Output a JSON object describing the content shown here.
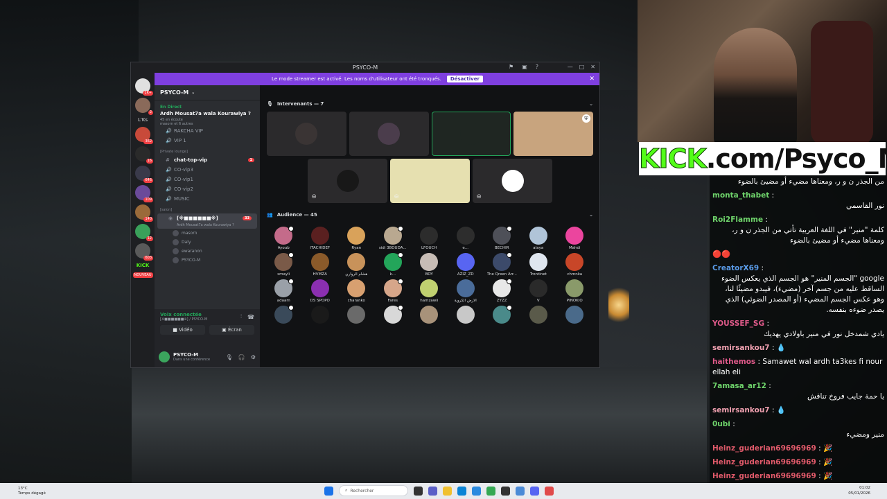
{
  "window": {
    "title": "PSYCO-M",
    "controls": [
      "minimize",
      "maximize",
      "close"
    ]
  },
  "banner": {
    "text": "Le mode streamer est activé. Les noms d'utilisateur ont été tronqués.",
    "button": "Désactiver"
  },
  "servers": {
    "labels": [
      "L'Ks",
      "KICK"
    ],
    "badges": [
      "1K+",
      "362",
      "16",
      "646",
      "109",
      "140",
      "12",
      "603",
      "35"
    ],
    "nouveau": "NOUVEAU"
  },
  "sidebar": {
    "guild_name": "PSYCO-M",
    "live_label": "En Direct",
    "live_title": "Ardh Mousat7a wala Kourawiya ?",
    "live_sub": "45 en écoute",
    "live_sub2": "masorn et 6 autres",
    "channels": [
      {
        "icon": "speaker",
        "label": "RAKCHA VIP"
      },
      {
        "icon": "speaker",
        "label": "VIP 1"
      }
    ],
    "category_private": "[Private lounge]",
    "private_channels": [
      {
        "icon": "hash",
        "label": "chat-top-vip",
        "count": "1"
      },
      {
        "icon": "speaker",
        "label": "CO-vip3"
      },
      {
        "icon": "speaker",
        "label": "CO-vip1"
      },
      {
        "icon": "speaker",
        "label": "CO-vip2"
      },
      {
        "icon": "speaker",
        "label": "MUSIC"
      }
    ],
    "category_salon": "[salon]",
    "active_stage": {
      "label": "[※■■■■■■※]",
      "sub": "Ardh Mousat7a wala Kourawiya ?",
      "count": "33"
    },
    "voice_users": [
      "masorn",
      "Daly",
      "ewaranon",
      "PSYCO-M"
    ]
  },
  "voice_panel": {
    "status": "Voix connectée",
    "sub": "[※■■■■■■※] / PSYCO-M",
    "video_label": "Vidéo",
    "screen_label": "Écran"
  },
  "user_panel": {
    "name": "PSYCO-M",
    "status": "Dans une conférence"
  },
  "stage": {
    "speakers_header": "Intervenants — 7",
    "audience_header": "Audience — 45",
    "speaker_colors": [
      "#3a3434",
      "#4b3d4c",
      "#1f2622",
      "#c8a47e",
      "#181818",
      "#e6e0b0",
      "#181818"
    ],
    "audience": [
      {
        "name": "Ayoub",
        "color": "#c46b8a"
      },
      {
        "name": "ITACHIDEF",
        "color": "#5a2020"
      },
      {
        "name": "Ryan",
        "color": "#d9a25a"
      },
      {
        "name": "sidi 3BOUDA...",
        "color": "#b9a890"
      },
      {
        "name": "LFOUCH",
        "color": "#2c2c2c"
      },
      {
        "name": "e...",
        "color": "#2d2d2d"
      },
      {
        "name": "BECHIR",
        "color": "#4e5058"
      },
      {
        "name": "alaya",
        "color": "#b0c4d8"
      },
      {
        "name": "Mahdi",
        "color": "#eb459e"
      },
      {
        "name": "smayli",
        "color": "#7a5a48"
      },
      {
        "name": "HVMZA",
        "color": "#8a5a2a"
      },
      {
        "name": "هشام الرواري",
        "color": "#c8925a"
      },
      {
        "name": "k...",
        "color": "#23a55a"
      },
      {
        "name": "BOY",
        "color": "#c7bcb5"
      },
      {
        "name": "AZIZ_ZD",
        "color": "#5865f2"
      },
      {
        "name": "The Qreen Arr...",
        "color": "#3c4a6a"
      },
      {
        "name": "Trontinet",
        "color": "#dfe6ef"
      },
      {
        "name": "chmnka",
        "color": "#c84628"
      },
      {
        "name": "adaam",
        "color": "#9aa0a8"
      },
      {
        "name": "DS SPOPO",
        "color": "#8b2fb0"
      },
      {
        "name": "charanko",
        "color": "#d8a070"
      },
      {
        "name": "Fares",
        "color": "#d6a68a"
      },
      {
        "name": "hamzawii",
        "color": "#c0d070"
      },
      {
        "name": "الأرض الكروية",
        "color": "#4a6c9a"
      },
      {
        "name": "ZYZZ",
        "color": "#e8e8e8"
      },
      {
        "name": "V",
        "color": "#2a2a2a"
      },
      {
        "name": "PINOKIO",
        "color": "#8a9a6a"
      },
      {
        "name": "",
        "color": "#3a4a5a"
      },
      {
        "name": "",
        "color": "#1a1a1a"
      },
      {
        "name": "",
        "color": "#6a6a6a"
      },
      {
        "name": "",
        "color": "#d8d8d8"
      },
      {
        "name": "",
        "color": "#a8927a"
      },
      {
        "name": "",
        "color": "#c8c8c8"
      },
      {
        "name": "",
        "color": "#4a8a8a"
      },
      {
        "name": "",
        "color": "#5a5a4a"
      },
      {
        "name": "",
        "color": "#4a6a8a"
      }
    ]
  },
  "stream": {
    "brand_kick": "KICK",
    "brand_rest": ".com/Psyco_M"
  },
  "chat": [
    {
      "user": "",
      "text": "من الجذر ن و ر، ومعناها مضيء أو مضيئ بالضوء",
      "color": "#ffffff"
    },
    {
      "user": "monta_thabet",
      "text": "نور القاسمي",
      "color": "#6fd46b"
    },
    {
      "user": "Roi2Flamme",
      "text": "كلمة \"منير\" في اللغة العربية تأتي من الجذر ن و ر، ومعناها مضيء أو مضيئ بالضوء",
      "color": "#6fd46b"
    },
    {
      "user": "",
      "text": "🔴🔴",
      "color": "#ffffff"
    },
    {
      "user": "CreatorX69",
      "text": "google \"الجسم المنير\" هو الجسم الذي يعكس الضوء الساقط عليه من جسم آخر (مضيء)، فيبدو مضيئًا لنا، وهو عكس الجسم المضيء (أو المصدر الضوئي) الذي يصدر ضوءه بنفسه.",
      "color": "#5a9be8"
    },
    {
      "user": "YOUSSEF_SG",
      "text": "يادي شمدخل نور في منير باولادي يهديك",
      "color": "#e05a8a"
    },
    {
      "user": "semirsankou7",
      "text": "💧",
      "color": "#f0a0b0"
    },
    {
      "user": "haithemos",
      "text": "Samawet wal ardh ta3kes fi nour ellah eli",
      "color": "#e05a8a"
    },
    {
      "user": "7amasa_ar12",
      "text": "يا حمة جايب فروخ تناقش",
      "color": "#6fd46b"
    },
    {
      "user": "semirsankou7",
      "text": "💧",
      "color": "#f0a0b0"
    },
    {
      "user": "0ubi",
      "text": "منير ومضيء",
      "color": "#6fd46b"
    },
    {
      "user": "Heinz_guderian69696969",
      "text": "🎉",
      "color": "#e05a6a"
    },
    {
      "user": "Heinz_guderian69696969",
      "text": "🎉",
      "color": "#e05a6a"
    },
    {
      "user": "Heinz_guderian69696969",
      "text": "🎉",
      "color": "#e05a6a"
    },
    {
      "user": "Heinz_guderian69696969",
      "text": "🎉",
      "color": "#e05a6a"
    },
    {
      "user": "Heinz_guderian69696969",
      "text": "🎉",
      "color": "#e05a6a"
    }
  ],
  "taskbar": {
    "weather_temp": "13°C",
    "weather_desc": "Temps dégagé",
    "search_placeholder": "Rechercher",
    "time": "01:02",
    "date": "05/01/2026"
  }
}
